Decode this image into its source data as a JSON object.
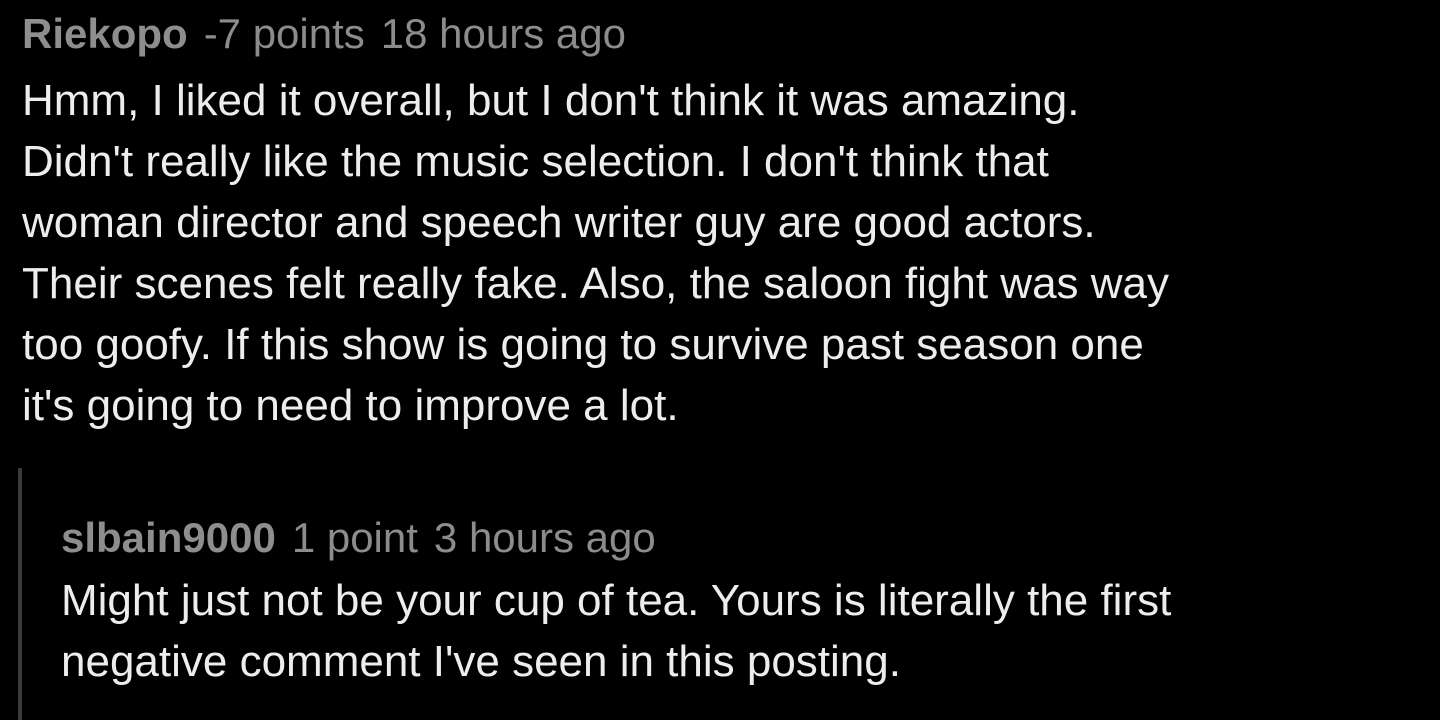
{
  "comment": {
    "author": "Riekopo",
    "points": "-7 points",
    "time": "18 hours ago",
    "body_lines": [
      "Hmm, I liked it overall, but I don't think it was amazing.",
      "Didn't really like the music selection. I don't think that",
      "woman director and speech writer guy are good actors.",
      "Their scenes felt really fake. Also, the saloon fight was way",
      "too goofy. If this show is going to survive past season one",
      "it's going to need to improve a lot."
    ]
  },
  "reply": {
    "author": "slbain9000",
    "points": "1 point",
    "time": "3 hours ago",
    "body_lines": [
      "Might just not be your cup of tea. Yours is literally the first",
      "negative comment I've seen in this posting."
    ]
  },
  "colors": {
    "background": "#000000",
    "text": "#ededed",
    "meta": "#8c8c8c",
    "thread_bar": "#3a3a3a"
  }
}
